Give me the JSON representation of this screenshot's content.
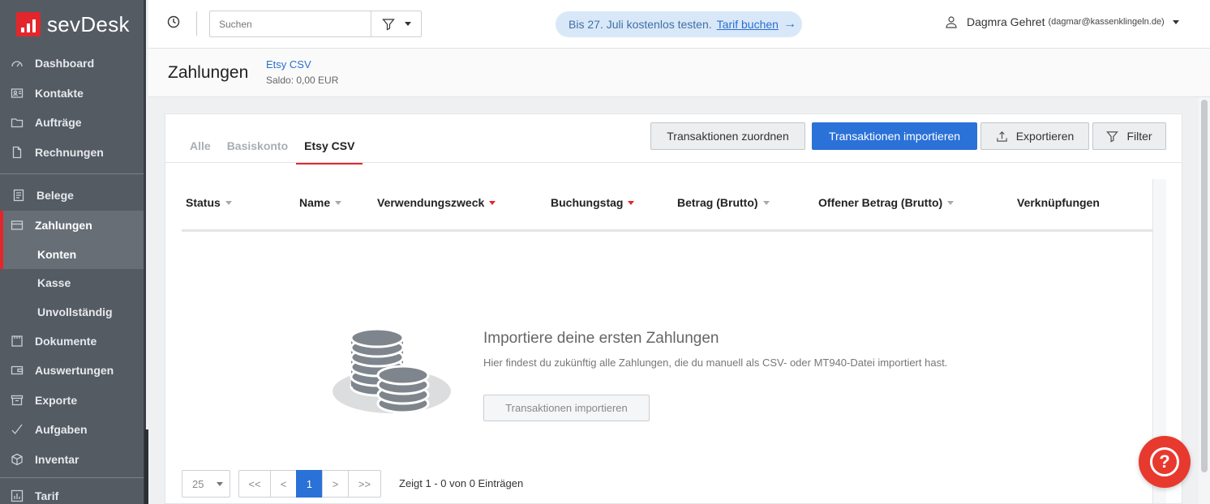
{
  "brand": {
    "name": "sevDesk",
    "color": "#e3262b"
  },
  "sidebar": {
    "items": [
      {
        "label": "Dashboard",
        "icon": "dashboard-icon"
      },
      {
        "label": "Kontakte",
        "icon": "contacts-icon"
      },
      {
        "label": "Aufträge",
        "icon": "folder-icon"
      },
      {
        "label": "Rechnungen",
        "icon": "document-icon"
      },
      {
        "label": "Belege",
        "icon": "receipt-icon"
      },
      {
        "label": "Zahlungen",
        "icon": "credit-card-icon"
      },
      {
        "label": "Dokumente",
        "icon": "archive-icon"
      },
      {
        "label": "Auswertungen",
        "icon": "wallet-icon"
      },
      {
        "label": "Exporte",
        "icon": "export-box-icon"
      },
      {
        "label": "Aufgaben",
        "icon": "check-icon"
      },
      {
        "label": "Inventar",
        "icon": "box-icon"
      },
      {
        "label": "Tarif",
        "icon": "chart-icon"
      }
    ],
    "sub_items": [
      {
        "label": "Konten"
      },
      {
        "label": "Kasse"
      },
      {
        "label": "Unvollständig"
      }
    ]
  },
  "topbar": {
    "search_placeholder": "Suchen",
    "trial_text": "Bis 27. Juli kostenlos testen.",
    "trial_link": "Tarif buchen",
    "trial_arrow": "→",
    "user_name": "Dagmra Gehret",
    "user_email": "(dagmar@kassenklingeln.de)"
  },
  "page": {
    "title": "Zahlungen",
    "account_name": "Etsy CSV",
    "saldo": "Saldo: 0,00 EUR"
  },
  "tabs": [
    {
      "label": "Alle"
    },
    {
      "label": "Basiskonto"
    },
    {
      "label": "Etsy CSV"
    }
  ],
  "actions": {
    "assign": "Transaktionen zuordnen",
    "import": "Transaktionen importieren",
    "export": "Exportieren",
    "filter": "Filter"
  },
  "table": {
    "columns": [
      {
        "label": "Status"
      },
      {
        "label": "Name"
      },
      {
        "label": "Verwendungszweck"
      },
      {
        "label": "Buchungstag"
      },
      {
        "label": "Betrag (Brutto)"
      },
      {
        "label": "Offener Betrag (Brutto)"
      },
      {
        "label": "Verknüpfungen"
      }
    ]
  },
  "empty_state": {
    "title": "Importiere deine ersten Zahlungen",
    "subtitle": "Hier findest du zukünftig alle Zahlungen, die du manuell als CSV- oder MT940-Datei importiert hast.",
    "button": "Transaktionen importieren"
  },
  "pagination": {
    "per_page": "25",
    "first": "<<",
    "prev": "<",
    "current": "1",
    "next": ">",
    "last": ">>",
    "info": "Zeigt 1 - 0 von 0 Einträgen"
  },
  "help": {
    "label": "?"
  }
}
